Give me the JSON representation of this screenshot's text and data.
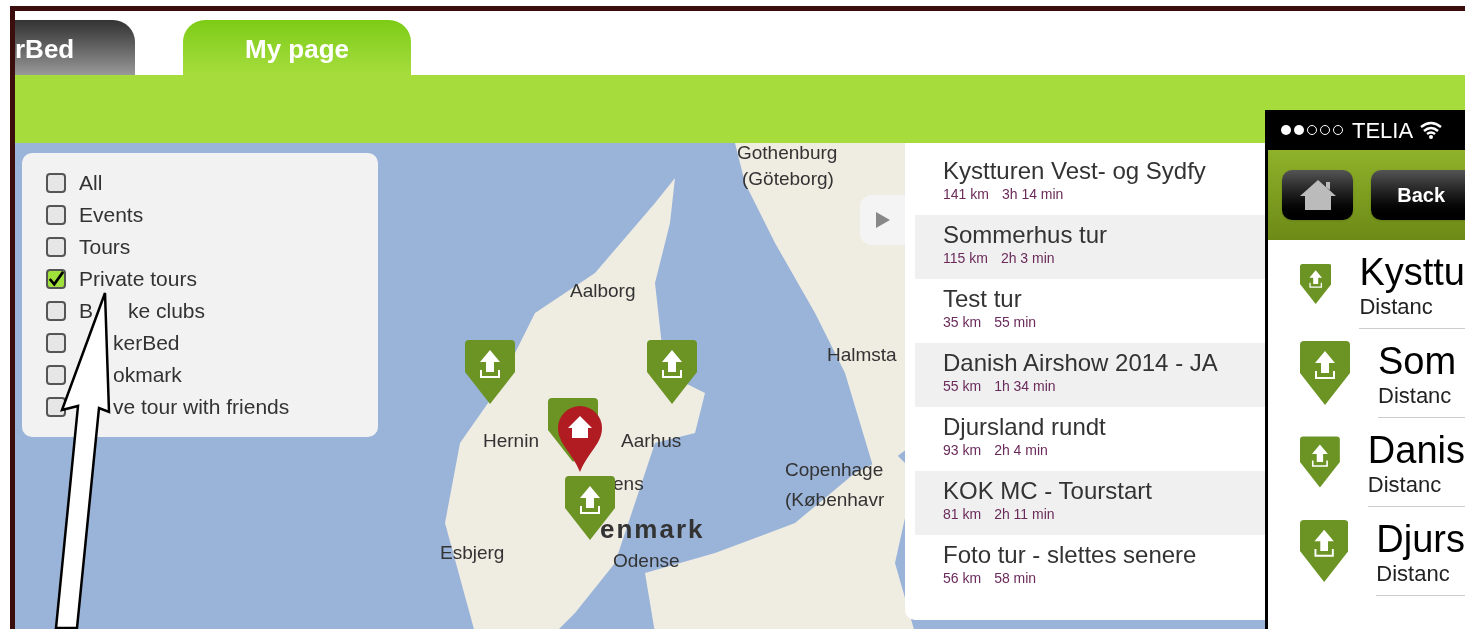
{
  "tabs": [
    {
      "label": "rBed",
      "selected": false
    },
    {
      "label": "My page",
      "selected": true
    }
  ],
  "filters": [
    {
      "label": "All",
      "checked": false
    },
    {
      "label": "Events",
      "checked": false
    },
    {
      "label": "Tours",
      "checked": false
    },
    {
      "label": "Private tours",
      "checked": true
    },
    {
      "label_start": "B",
      "label": "ke clubs",
      "checked": false
    },
    {
      "label": "kerBed",
      "checked": false
    },
    {
      "label": "okmark",
      "checked": false
    },
    {
      "label": "ve tour with friends",
      "checked": false
    }
  ],
  "map": {
    "labels": [
      "Gothenburg",
      "(Göteborg)",
      "Aalborg",
      "Halmsta",
      "Hernin",
      "Aarhus",
      "ens",
      "Copenhage",
      "(Københavr",
      "enmark",
      "Esbjerg",
      "Odense"
    ],
    "pins": [
      {
        "kind": "tour"
      },
      {
        "kind": "tour"
      },
      {
        "kind": "home"
      },
      {
        "kind": "tour"
      }
    ]
  },
  "routes": [
    {
      "title": "Kystturen Vest- og Sydfy",
      "distance": "141 km",
      "duration": "3h 14 min"
    },
    {
      "title": "Sommerhus tur",
      "distance": "115 km",
      "duration": "2h 3 min"
    },
    {
      "title": "Test tur",
      "distance": "35 km",
      "duration": "55 min"
    },
    {
      "title": "Danish Airshow 2014 - JA",
      "distance": "55 km",
      "duration": "1h 34 min"
    },
    {
      "title": "Djursland rundt",
      "distance": "93 km",
      "duration": "2h 4 min"
    },
    {
      "title": "KOK MC - Tourstart",
      "distance": "81 km",
      "duration": "2h 11 min"
    },
    {
      "title": "Foto tur - slettes senere",
      "distance": "56 km",
      "duration": "58 min"
    }
  ],
  "phone": {
    "carrier": "TELIA",
    "back_button": "Back",
    "rows": [
      {
        "title": "Kysttu",
        "subtitle": "Distanc"
      },
      {
        "title": "Som",
        "subtitle": "Distanc"
      },
      {
        "title": "Danis",
        "subtitle": "Distanc"
      },
      {
        "title": "Djurs",
        "subtitle": "Distanc"
      }
    ]
  }
}
